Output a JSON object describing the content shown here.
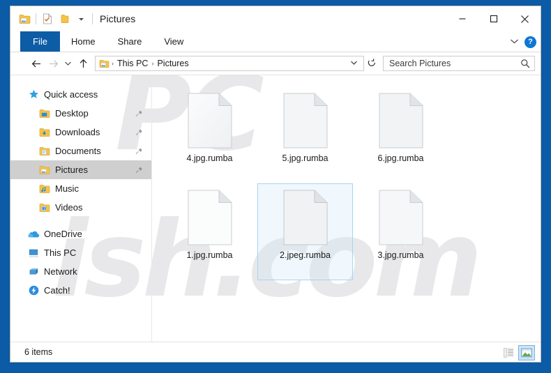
{
  "window": {
    "title": "Pictures",
    "quick_access_icons": [
      "folder-pictures-icon",
      "properties-icon",
      "new-folder-icon",
      "customize-chevron-icon"
    ],
    "caption": {
      "minimize": "minimize-icon",
      "maximize": "maximize-icon",
      "close": "close-icon"
    }
  },
  "ribbon": {
    "tabs": [
      {
        "label": "File",
        "active": true
      },
      {
        "label": "Home",
        "active": false
      },
      {
        "label": "Share",
        "active": false
      },
      {
        "label": "View",
        "active": false
      }
    ],
    "expand_label": "⌄",
    "help_label": "?"
  },
  "address": {
    "back_icon": "back-arrow-icon",
    "forward_icon": "forward-arrow-icon",
    "recent_icon": "recent-locations-chevron-icon",
    "up_icon": "up-arrow-icon",
    "breadcrumbs": [
      "This PC",
      "Pictures"
    ],
    "separator": "›",
    "dropdown_icon": "address-dropdown-chevron",
    "refresh_icon": "refresh-icon"
  },
  "search": {
    "placeholder": "Search Pictures",
    "icon": "search-icon"
  },
  "sidebar": {
    "items": [
      {
        "label": "Quick access",
        "icon": "star-icon",
        "indent": false,
        "pinned": false,
        "selected": false
      },
      {
        "label": "Desktop",
        "icon": "folder-desktop-icon",
        "indent": true,
        "pinned": true,
        "selected": false
      },
      {
        "label": "Downloads",
        "icon": "folder-downloads-icon",
        "indent": true,
        "pinned": true,
        "selected": false
      },
      {
        "label": "Documents",
        "icon": "folder-documents-icon",
        "indent": true,
        "pinned": true,
        "selected": false
      },
      {
        "label": "Pictures",
        "icon": "folder-pictures-icon",
        "indent": true,
        "pinned": true,
        "selected": true
      },
      {
        "label": "Music",
        "icon": "folder-music-icon",
        "indent": true,
        "pinned": false,
        "selected": false
      },
      {
        "label": "Videos",
        "icon": "folder-videos-icon",
        "indent": true,
        "pinned": false,
        "selected": false
      },
      {
        "label": "OneDrive",
        "icon": "onedrive-cloud-icon",
        "indent": false,
        "pinned": false,
        "selected": false
      },
      {
        "label": "This PC",
        "icon": "this-pc-monitor-icon",
        "indent": false,
        "pinned": false,
        "selected": false
      },
      {
        "label": "Network",
        "icon": "network-icon",
        "indent": false,
        "pinned": false,
        "selected": false
      },
      {
        "label": "Catch!",
        "icon": "catch-app-icon",
        "indent": false,
        "pinned": false,
        "selected": false
      }
    ]
  },
  "files": [
    {
      "name": "4.jpg.rumba",
      "selected": false
    },
    {
      "name": "5.jpg.rumba",
      "selected": false
    },
    {
      "name": "6.jpg.rumba",
      "selected": false
    },
    {
      "name": "1.jpg.rumba",
      "selected": false
    },
    {
      "name": "2.jpeg.rumba",
      "selected": true
    },
    {
      "name": "3.jpg.rumba",
      "selected": false
    }
  ],
  "status": {
    "item_count": "6 items",
    "views": [
      {
        "name": "details-view",
        "active": false
      },
      {
        "name": "large-icons-view",
        "active": true
      }
    ]
  },
  "watermark": {
    "line1": "PC",
    "line2": "ish.com"
  },
  "colors": {
    "accent": "#0d5ca6",
    "desktop": "#0b5ba6",
    "selection": "#cce4f7",
    "selection_border": "#a8d4f0",
    "folder_yellow": "#ffd24d"
  }
}
